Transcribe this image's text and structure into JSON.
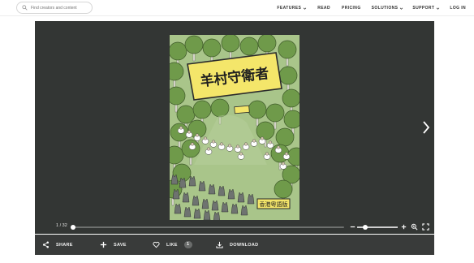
{
  "search": {
    "placeholder": "Find creators and content"
  },
  "nav": {
    "features": "FEATURES",
    "read": "READ",
    "pricing": "PRICING",
    "solutions": "SOLUTIONS",
    "support": "SUPPORT",
    "login": "LOG IN"
  },
  "viewer": {
    "page_count": "1 / 32",
    "progress": 0.0,
    "zoom_level": 0.2,
    "book": {
      "title": "羊村守衛者",
      "publisher_badge": "香港粵語版"
    }
  },
  "actions": {
    "share": "SHARE",
    "save": "SAVE",
    "like": "LIKE",
    "like_count": "1",
    "download": "DOWNLOAD"
  }
}
